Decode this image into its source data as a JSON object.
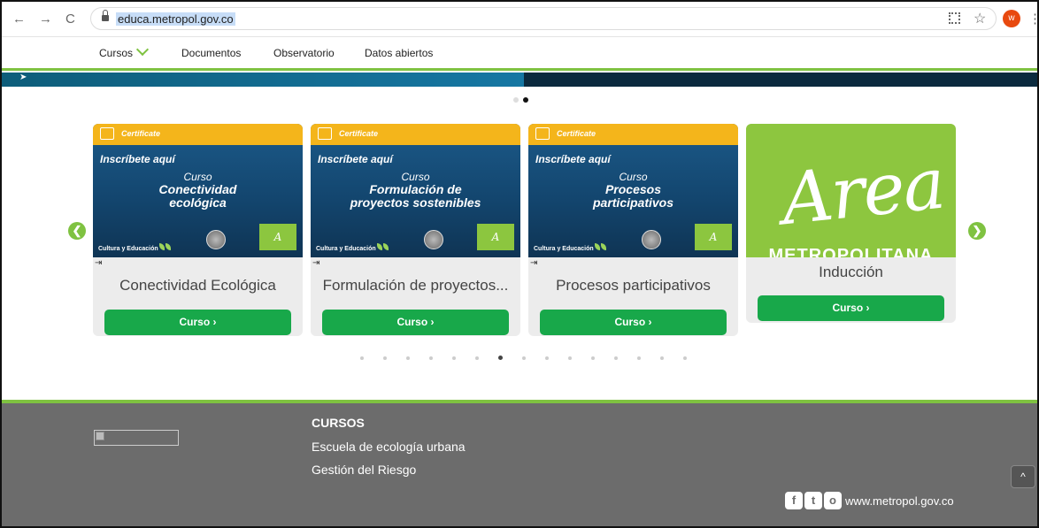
{
  "browser": {
    "back": "←",
    "forward": "→",
    "reload": "C",
    "url": "educa.metropol.gov.co",
    "star": "☆",
    "avatar_initial": "w",
    "menu": "⋮"
  },
  "nav": {
    "items": [
      "Cursos",
      "Documentos",
      "Observatorio",
      "Datos abiertos"
    ]
  },
  "carousel": {
    "prev": "❮",
    "next": "❯",
    "cards": [
      {
        "banner_label": "Certificate",
        "inscribe": "Inscríbete aquí",
        "curso_word": "Curso",
        "course_line1": "Conectividad",
        "course_line2": "ecológica",
        "footer_text": "Cultura y Educación",
        "title": "Conectividad Ecológica",
        "button": "Curso ›"
      },
      {
        "banner_label": "Certificate",
        "inscribe": "Inscríbete aquí",
        "curso_word": "Curso",
        "course_line1": "Formulación de",
        "course_line2": "proyectos sostenibles",
        "footer_text": "Cultura y Educación",
        "title": "Formulación de proyectos...",
        "button": "Curso ›"
      },
      {
        "banner_label": "Certificate",
        "inscribe": "Inscríbete aquí",
        "curso_word": "Curso",
        "course_line1": "Procesos",
        "course_line2": "participativos",
        "footer_text": "Cultura y Educación",
        "title": "Procesos participativos",
        "button": "Curso ›"
      },
      {
        "logo_text": "Area",
        "logo_sub": "METROPOLITANA",
        "title": "Inducción",
        "button": "Curso ›"
      }
    ],
    "page_count": 15,
    "active_page": 6
  },
  "footer": {
    "heading": "CURSOS",
    "links": [
      "Escuela de ecología urbana",
      "Gestión del Riesgo"
    ],
    "scroll_top": "^",
    "social": [
      "f",
      "t",
      "o"
    ],
    "website": "www.metropol.gov.co"
  },
  "colors": {
    "accent_green": "#7fc241",
    "button_green": "#18a84a",
    "cert_yellow": "#f4b51b",
    "footer_gray": "#6c6c6c"
  }
}
